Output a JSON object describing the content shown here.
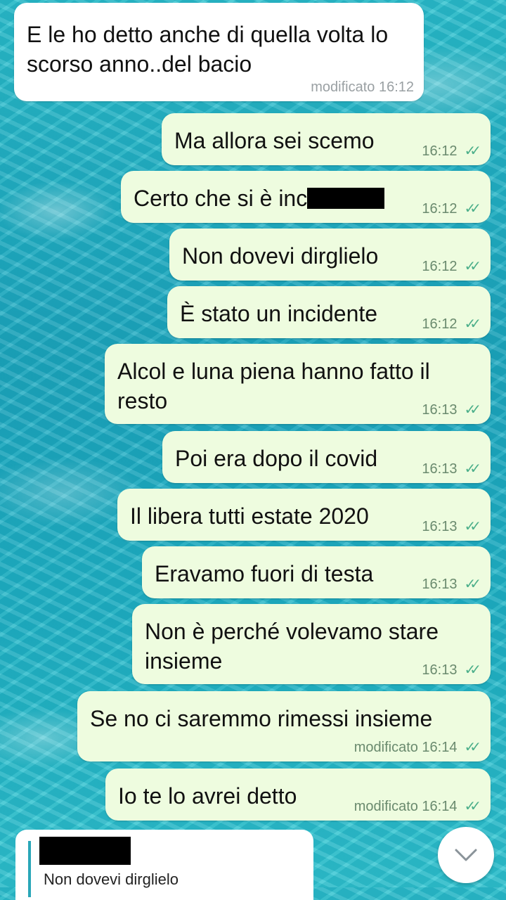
{
  "messages": [
    {
      "dir": "in",
      "text": "E le ho detto anche di quella volta lo scorso anno..del bacio",
      "meta": "modificato 16:12"
    },
    {
      "dir": "out",
      "text": "Ma allora sei scemo",
      "time": "16:12"
    },
    {
      "dir": "out",
      "text": "Certo che si è inc",
      "time": "16:12"
    },
    {
      "dir": "out",
      "text": "Non dovevi dirglielo",
      "time": "16:12"
    },
    {
      "dir": "out",
      "text": "È stato un incidente",
      "time": "16:12"
    },
    {
      "dir": "out",
      "text": "Alcol e luna piena hanno fatto il resto",
      "time": "16:13"
    },
    {
      "dir": "out",
      "text": "Poi era dopo il covid",
      "time": "16:13"
    },
    {
      "dir": "out",
      "text": "Il libera tutti estate 2020",
      "time": "16:13"
    },
    {
      "dir": "out",
      "text": "Eravamo fuori di testa",
      "time": "16:13"
    },
    {
      "dir": "out",
      "text": "Non è perché volevamo stare insieme",
      "time": "16:13"
    },
    {
      "dir": "out",
      "text": "Se no ci saremmo rimessi insieme",
      "time": "modificato 16:14"
    },
    {
      "dir": "out",
      "text": "Io te lo avrei detto",
      "time": "modificato 16:14"
    }
  ],
  "ticks": "✓✓",
  "reply_preview": {
    "quoted_text": "Non dovevi dirglielo"
  },
  "scroll_button": {
    "icon": "chevron-down-icon"
  },
  "colors": {
    "incoming_bubble": "#ffffff",
    "outgoing_bubble": "#eefcdf",
    "tick": "#4caf8a",
    "background": "#23b6c8"
  }
}
